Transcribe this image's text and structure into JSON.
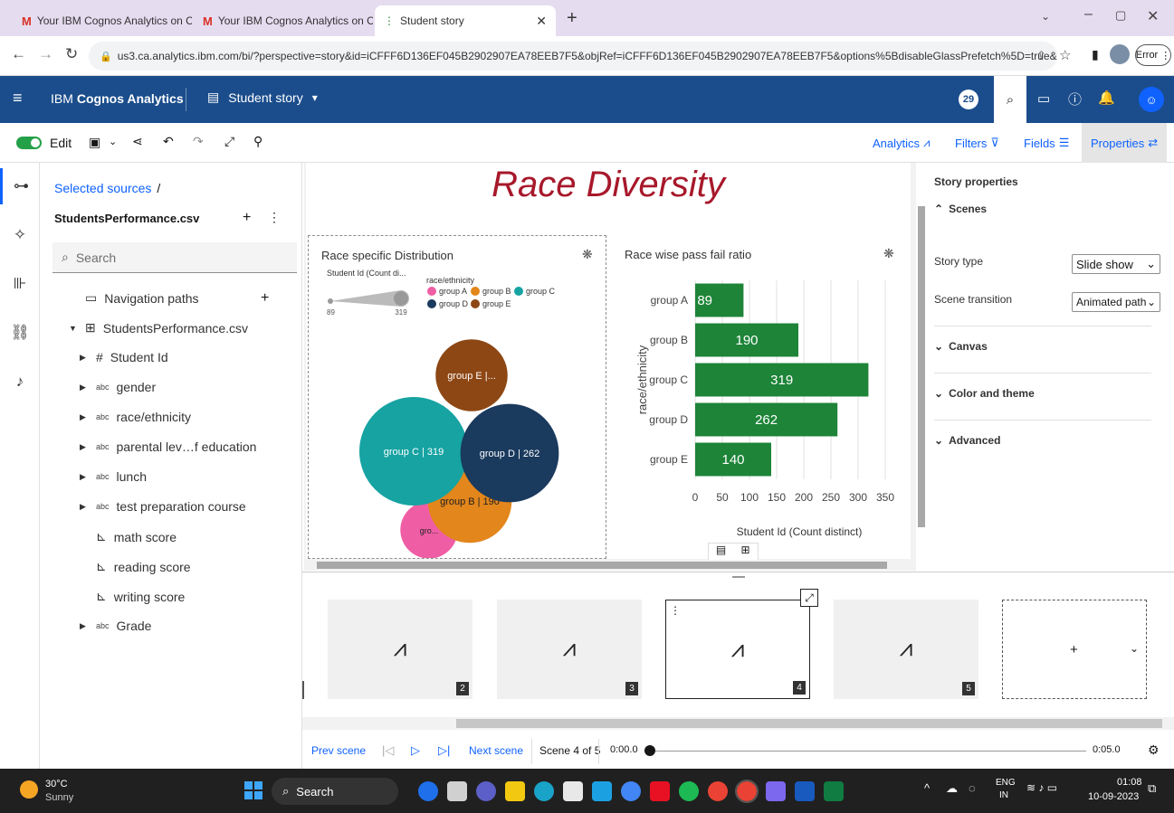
{
  "browser": {
    "tabs": [
      {
        "label": "Your IBM Cognos Analytics on Cl"
      },
      {
        "label": "Your IBM Cognos Analytics on Cl"
      },
      {
        "label": "Student story"
      }
    ],
    "url": "us3.ca.analytics.ibm.com/bi/?perspective=story&id=iCFFF6D136EF045B2902907EA78EEB7F5&objRef=iCFFF6D136EF045B2902907EA78EEB7F5&options%5BdisableGlassPrefetch%5D=true&...",
    "error_label": "Error"
  },
  "app": {
    "brand_prefix": "IBM",
    "brand_name": "Cognos Analytics",
    "story_name": "Student story",
    "notification_count": "29"
  },
  "toolbar": {
    "edit_label": "Edit",
    "analytics": "Analytics",
    "filters": "Filters",
    "fields": "Fields",
    "properties": "Properties"
  },
  "sources": {
    "breadcrumb": "Selected sources",
    "breadcrumb_sep": "/",
    "file": "StudentsPerformance.csv",
    "search_placeholder": "Search",
    "nav_paths": "Navigation paths",
    "dataset": "StudentsPerformance.csv",
    "fields": [
      {
        "label": "Student Id",
        "icon": "#"
      },
      {
        "label": "gender",
        "icon": "abc"
      },
      {
        "label": "race/ethnicity",
        "icon": "abc"
      },
      {
        "label": "parental lev…f education",
        "icon": "abc"
      },
      {
        "label": "lunch",
        "icon": "abc"
      },
      {
        "label": "test preparation course",
        "icon": "abc"
      },
      {
        "label": "math score",
        "icon": "measure"
      },
      {
        "label": "reading score",
        "icon": "measure"
      },
      {
        "label": "writing score",
        "icon": "measure"
      },
      {
        "label": "Grade",
        "icon": "abc"
      }
    ]
  },
  "scene": {
    "title": "Race Diversity",
    "title_color": "#a7182a"
  },
  "chart_data": [
    {
      "type": "bubble",
      "title": "Race specific Distribution",
      "size_legend_label": "Student Id (Count di...",
      "size_min": 89,
      "size_max": 319,
      "size_min_label": "89",
      "size_max_label": "319",
      "color_legend_title": "race/ethnicity",
      "series": [
        {
          "name": "group A",
          "value": 89,
          "label": "gro...",
          "color": "#ef5ea5"
        },
        {
          "name": "group B",
          "value": 190,
          "label": "group B | 190",
          "color": "#e3861b"
        },
        {
          "name": "group C",
          "value": 319,
          "label": "group C | 319",
          "color": "#16a3a2"
        },
        {
          "name": "group D",
          "value": 262,
          "label": "group D | 262",
          "color": "#1a3a5e"
        },
        {
          "name": "group E",
          "value": 140,
          "label": "group E |...",
          "color": "#8d4714"
        }
      ]
    },
    {
      "type": "bar",
      "orientation": "horizontal",
      "title": "Race wise pass fail ratio",
      "categories": [
        "group A",
        "group B",
        "group C",
        "group D",
        "group E"
      ],
      "values": [
        89,
        190,
        319,
        262,
        140
      ],
      "value_labels": [
        "89",
        "190",
        "319",
        "262",
        "140"
      ],
      "xlabel": "Student Id (Count distinct)",
      "ylabel": "race/ethnicity",
      "xlim": [
        0,
        350
      ],
      "xticks": [
        "0",
        "50",
        "100",
        "150",
        "200",
        "250",
        "300",
        "350"
      ],
      "bar_color": "#1d8438"
    }
  ],
  "properties": {
    "title": "Story properties",
    "scenes": "Scenes",
    "story_type_label": "Story type",
    "story_type_value": "Slide show",
    "transition_label": "Scene transition",
    "transition_value": "Animated path",
    "canvas": "Canvas",
    "color_theme": "Color and theme",
    "advanced": "Advanced"
  },
  "timeline": {
    "scene_numbers": [
      "2",
      "3",
      "4",
      "5"
    ],
    "add": "+",
    "prev": "Prev scene",
    "next": "Next scene",
    "scene_count": "Scene 4 of 5",
    "time_start": "0:00.0",
    "time_end": "0:05.0"
  },
  "taskbar": {
    "temp": "30°C",
    "weather": "Sunny",
    "search": "Search",
    "lang": "ENG",
    "region": "IN",
    "time": "01:08",
    "date": "10-09-2023"
  }
}
